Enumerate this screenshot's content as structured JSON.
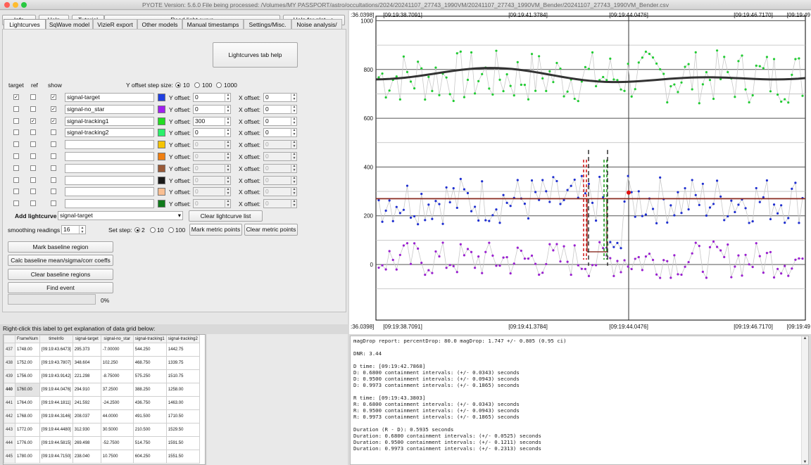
{
  "window": {
    "title": "PYOTE Version: 5.6.0   File being processed: /Volumes/MY PASSPORT/astro/occultations/2024/20241107_27743_1990VM/20241107_27743_1990VM_Bender/20241107_27743_1990VM_Bender.csv"
  },
  "toolbar": {
    "info": "Info",
    "help": "Help",
    "tutorial": "Tutorial",
    "read_light_curve": "Read light curve",
    "help_for_plot": "Help for plot -->"
  },
  "tabs": [
    "Lightcurves",
    "SqWave model",
    "VizieR export",
    "Other models",
    "Manual timestamps",
    "Settings/Misc.",
    "Noise analysis/"
  ],
  "lightcurves_tab_help": "Lightcurves tab help",
  "y_offset_step": {
    "label": "Y offset step size:",
    "options": [
      "10",
      "100",
      "1000"
    ],
    "selected": "10"
  },
  "table_headers": {
    "target": "target",
    "ref": "ref",
    "show": "show"
  },
  "y_offset_label": "Y offset:",
  "x_offset_label": "X offset:",
  "curves": [
    {
      "name": "signal-target",
      "target": true,
      "ref": false,
      "show": true,
      "color": "#1f3fe0",
      "y": "0",
      "x": "0",
      "enabled": true
    },
    {
      "name": "signal-no_star",
      "target": false,
      "ref": false,
      "show": true,
      "color": "#a020f0",
      "y": "0",
      "x": "0",
      "enabled": true
    },
    {
      "name": "signal-tracking1",
      "target": false,
      "ref": true,
      "show": true,
      "color": "#22dd22",
      "y": "300",
      "x": "0",
      "enabled": true
    },
    {
      "name": "signal-tracking2",
      "target": false,
      "ref": false,
      "show": false,
      "color": "#2af06a",
      "y": "0",
      "x": "0",
      "enabled": true
    },
    {
      "name": "",
      "target": false,
      "ref": false,
      "show": false,
      "color": "#f5c400",
      "y": "0",
      "x": "0",
      "enabled": false
    },
    {
      "name": "",
      "target": false,
      "ref": false,
      "show": false,
      "color": "#f07f10",
      "y": "0",
      "x": "0",
      "enabled": false
    },
    {
      "name": "",
      "target": false,
      "ref": false,
      "show": false,
      "color": "#9a5a38",
      "y": "0",
      "x": "0",
      "enabled": false
    },
    {
      "name": "",
      "target": false,
      "ref": false,
      "show": false,
      "color": "#1a1a1a",
      "y": "0",
      "x": "0",
      "enabled": false
    },
    {
      "name": "",
      "target": false,
      "ref": false,
      "show": false,
      "color": "#f9bf92",
      "y": "0",
      "x": "0",
      "enabled": false
    },
    {
      "name": "",
      "target": false,
      "ref": false,
      "show": false,
      "color": "#0f7a1a",
      "y": "0",
      "x": "0",
      "enabled": false
    }
  ],
  "add_lightcurve": {
    "label": "Add lightcurve",
    "value": "signal-target"
  },
  "clear_lightcurve_list": "Clear lightcurve list",
  "smoothing": {
    "label": "smoothing readings",
    "value": "16"
  },
  "set_step": {
    "label": "Set step:",
    "options": [
      "2",
      "10",
      "100"
    ],
    "selected": "2"
  },
  "mark_metric_points": "Mark metric points",
  "clear_metric_points": "Clear metric points",
  "mark_baseline_region": "Mark baseline region",
  "calc_baseline": "Calc baseline mean/sigma/corr coeffs",
  "clear_baseline_regions": "Clear baseline regions",
  "find_event": "Find event",
  "progress": {
    "value": 0,
    "text": "0%"
  },
  "plot": {
    "y_ticks": [
      "1000",
      "800",
      "600",
      "400",
      "200",
      "0"
    ],
    "x_ticks": [
      ":36.0398]",
      "[09:19:38.7091]",
      "[09:19:41.3784]",
      "[09:19:44.0476]",
      "[09:19:46.7170]",
      "[09:19:49"
    ]
  },
  "grid": {
    "label": "Right-click this label to get explanation of data grid below:",
    "columns": [
      "FrameNum",
      "timeInfo",
      "signal-target",
      "signal-no_star",
      "signal-tracking1",
      "signal-tracking2"
    ],
    "rows": [
      {
        "idx": "437",
        "cells": [
          "1748.00",
          "[09:19:43.6473]",
          "295.373",
          "-7.00000",
          "544.250",
          "1442.75"
        ]
      },
      {
        "idx": "438",
        "cells": [
          "1752.00",
          "[09:19:43.7807]",
          "348.604",
          "102.250",
          "468.750",
          "1339.75"
        ]
      },
      {
        "idx": "439",
        "cells": [
          "1756.00",
          "[09:19:43.9142]",
          "221.298",
          "-8.75000",
          "575.250",
          "1510.75"
        ]
      },
      {
        "idx": "440",
        "cells": [
          "1760.00",
          "[09:19:44.0476]",
          "294.910",
          "37.2500",
          "388.250",
          "1258.00"
        ]
      },
      {
        "idx": "441",
        "cells": [
          "1764.00",
          "[09:19:44.1811]",
          "241.592",
          "-24.2500",
          "436.750",
          "1463.00"
        ]
      },
      {
        "idx": "442",
        "cells": [
          "1768.00",
          "[09:19:44.3146]",
          "208.037",
          "44.0000",
          "491.500",
          "1710.50"
        ]
      },
      {
        "idx": "443",
        "cells": [
          "1772.00",
          "[09:19:44.4480]",
          "312.930",
          "30.5000",
          "210.500",
          "1529.50"
        ]
      },
      {
        "idx": "444",
        "cells": [
          "1776.00",
          "[09:19:44.5815]",
          "269.498",
          "-52.7500",
          "514.750",
          "1591.50"
        ]
      },
      {
        "idx": "445",
        "cells": [
          "1780.00",
          "[09:19:44.7150]",
          "238.040",
          "10.7500",
          "604.250",
          "1551.50"
        ]
      }
    ]
  },
  "report": {
    "lines": [
      "magDrop report: percentDrop: 80.0 magDrop: 1.747 +/- 0.805 (0.95 ci)",
      "",
      "DNR: 3.44",
      "",
      "D time: [09:19:42.7868]",
      "D: 0.6800 containment intervals: (+/- 0.0343) seconds",
      "D: 0.9500 containment intervals: (+/- 0.0943) seconds",
      "D: 0.9973 containment intervals: (+/- 0.1865) seconds",
      "",
      "R time: [09:19:43.3803]",
      "R: 0.6800 containment intervals: (+/- 0.0343) seconds",
      "R: 0.9500 containment intervals: (+/- 0.0943) seconds",
      "R: 0.9973 containment intervals: (+/- 0.1865) seconds",
      "",
      "Duration (R - D): 0.5935 seconds",
      "Duration: 0.6800 containment intervals: (+/- 0.0525) seconds",
      "Duration: 0.9500 containment intervals: (+/- 0.1211) seconds",
      "Duration: 0.9973 containment intervals: (+/- 0.2313) seconds"
    ]
  }
}
